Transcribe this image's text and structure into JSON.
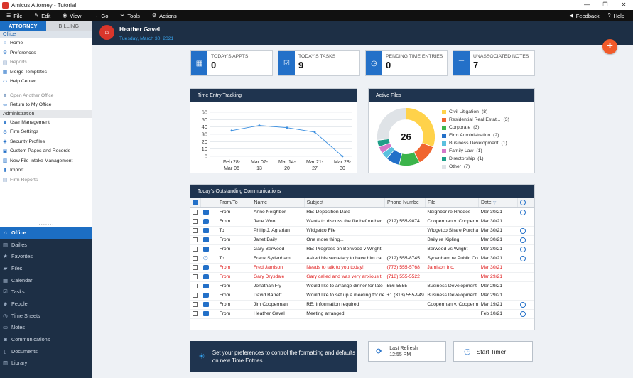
{
  "window": {
    "title": "Amicus Attorney - Tutorial",
    "controls": [
      "—",
      "❐",
      "✕"
    ]
  },
  "menubar": {
    "items": [
      {
        "label": "File",
        "icon": "hamburger-icon"
      },
      {
        "label": "Edit",
        "icon": "pencil-icon"
      },
      {
        "label": "View",
        "icon": "eye-icon"
      },
      {
        "label": "Go",
        "icon": "arrow-icon"
      },
      {
        "label": "Tools",
        "icon": "wrench-icon"
      },
      {
        "label": "Actions",
        "icon": "gear-icon"
      }
    ],
    "right": [
      {
        "label": "Feedback",
        "icon": "megaphone-icon"
      },
      {
        "label": "Help",
        "icon": "help-icon"
      }
    ]
  },
  "sidebar": {
    "tabs": [
      "ATTORNEY",
      "BILLING"
    ],
    "office_header": "Office",
    "office_links": [
      {
        "label": "Home",
        "enabled": true
      },
      {
        "label": "Preferences",
        "enabled": true
      },
      {
        "label": "Reports",
        "enabled": false
      },
      {
        "label": "Merge Templates",
        "enabled": true
      },
      {
        "label": "Help Center",
        "enabled": true
      }
    ],
    "other_links": [
      {
        "label": "Open Another Office",
        "enabled": false
      },
      {
        "label": "Return to My Office",
        "enabled": true
      }
    ],
    "admin_header": "Administration",
    "admin_links": [
      {
        "label": "User Management",
        "enabled": true
      },
      {
        "label": "Firm Settings",
        "enabled": true
      },
      {
        "label": "Security Profiles",
        "enabled": true
      },
      {
        "label": "Custom Pages and Records",
        "enabled": true
      },
      {
        "label": "New File Intake Management",
        "enabled": true
      },
      {
        "label": "Import",
        "enabled": true
      },
      {
        "label": "Firm Reports",
        "enabled": false
      }
    ],
    "nav": [
      "Office",
      "Dailies",
      "Favorites",
      "Files",
      "Calendar",
      "Tasks",
      "People",
      "Time Sheets",
      "Notes",
      "Communications",
      "Documents",
      "Library"
    ],
    "nav_active": "Office"
  },
  "header": {
    "user_name": "Heather Gavel",
    "date": "Tuesday, March 30, 2021",
    "fab_label": "+"
  },
  "kpis": [
    {
      "label": "TODAY'S APPTS",
      "value": "0",
      "icon": "calendar-icon"
    },
    {
      "label": "TODAY'S TASKS",
      "value": "9",
      "icon": "checkbox-icon"
    },
    {
      "label": "PENDING TIME ENTRIES",
      "value": "0",
      "icon": "clock-icon"
    },
    {
      "label": "UNASSOCIATED NOTES",
      "value": "7",
      "icon": "note-icon"
    }
  ],
  "time_panel_title": "Time Entry Tracking",
  "chart_data": {
    "type": "line",
    "categories": [
      "Feb 28-\nMar 06",
      "Mar 07-\n13",
      "Mar 14-\n20",
      "Mar 21-\n27",
      "Mar 28-\n30"
    ],
    "values": [
      35,
      42,
      39,
      33,
      0
    ],
    "ylim": [
      0,
      60
    ],
    "yticks": [
      0,
      10,
      20,
      30,
      40,
      50,
      60
    ],
    "title": "",
    "xlabel": "",
    "ylabel": "",
    "grid": true,
    "color": "#3b8fe0"
  },
  "active_files": {
    "title": "Active Files",
    "total": "26",
    "items": [
      {
        "label": "Civil Litigation",
        "count": "(8)",
        "value": 8,
        "color": "#ffd24a"
      },
      {
        "label": "Residential Real Estat...",
        "count": "(3)",
        "value": 3,
        "color": "#f0652f"
      },
      {
        "label": "Corporate",
        "count": "(3)",
        "value": 3,
        "color": "#3cb44b"
      },
      {
        "label": "Firm Administration",
        "count": "(2)",
        "value": 2,
        "color": "#2370c8"
      },
      {
        "label": "Business Development",
        "count": "(1)",
        "value": 1,
        "color": "#5bc0de"
      },
      {
        "label": "Family Law",
        "count": "(1)",
        "value": 1,
        "color": "#d477c9"
      },
      {
        "label": "Directorship",
        "count": "(1)",
        "value": 1,
        "color": "#1f9e89"
      },
      {
        "label": "Other",
        "count": "(7)",
        "value": 7,
        "color": "#dfe3e7"
      }
    ]
  },
  "communications": {
    "title": "Today's Outstanding Communications",
    "columns": [
      "From/To",
      "Name",
      "Subject",
      "Phone Numbe",
      "File",
      "Date"
    ],
    "rows": [
      {
        "type": "email",
        "dir": "From",
        "name": "Anne Neighbor",
        "subject": "RE: Deposition Date",
        "phone": "",
        "file": "Neighbor re Rhodes",
        "date": "Mar 30/21",
        "clock": true,
        "red": false
      },
      {
        "type": "note",
        "dir": "From",
        "name": "Jane Woo",
        "subject": "Wants to discuss the file before her",
        "phone": "(212) 555-9874",
        "file": "Cooperman v. Cooperm",
        "date": "Mar 30/21",
        "clock": false,
        "red": false
      },
      {
        "type": "email",
        "dir": "To",
        "name": "Philip J. Agrarian",
        "subject": "Widgetco File",
        "phone": "",
        "file": "Widgetco Share Purcha",
        "date": "Mar 30/21",
        "clock": true,
        "red": false
      },
      {
        "type": "email",
        "dir": "From",
        "name": "Janet Baily",
        "subject": "One more thing...",
        "phone": "",
        "file": "Baily re Kipling",
        "date": "Mar 30/21",
        "clock": true,
        "red": false
      },
      {
        "type": "email",
        "dir": "From",
        "name": "Gary Berwood",
        "subject": "RE: Progress on Berwood v Wright",
        "phone": "",
        "file": "Berwood vs Wright",
        "date": "Mar 30/21",
        "clock": true,
        "red": false
      },
      {
        "type": "phone",
        "dir": "To",
        "name": "Frank Sydenham",
        "subject": "Asked his secretary to have him ca",
        "phone": "(212) 555-8745",
        "file": "Sydenham re Public Co",
        "date": "Mar 30/21",
        "clock": true,
        "red": false
      },
      {
        "type": "note",
        "dir": "From",
        "name": "Fred Jamison",
        "subject": "Needs to talk to you today!",
        "phone": "(773) 555-5768",
        "file": "Jamison Inc.",
        "date": "Mar 30/21",
        "clock": false,
        "red": true
      },
      {
        "type": "note",
        "dir": "From",
        "name": "Gary Drysdale",
        "subject": "Gary called and was very anxious t",
        "phone": "(718) 555-5522",
        "file": "",
        "date": "Mar 29/21",
        "clock": false,
        "red": true
      },
      {
        "type": "note",
        "dir": "From",
        "name": "Jonathan Fly",
        "subject": "Would like to arrange dinner for late",
        "phone": "556-5555",
        "file": "Business Development",
        "date": "Mar 29/21",
        "clock": false,
        "red": false
      },
      {
        "type": "note",
        "dir": "From",
        "name": "David Barrett",
        "subject": "Would like to set up a meeting for ne",
        "phone": "+1 (313) 555-949",
        "file": "Business Development",
        "date": "Mar 29/21",
        "clock": false,
        "red": false
      },
      {
        "type": "email",
        "dir": "From",
        "name": "Jim Cooperman",
        "subject": "RE: Information required",
        "phone": "",
        "file": "Cooperman v. Cooperm",
        "date": "Mar 19/21",
        "clock": true,
        "red": false
      },
      {
        "type": "email",
        "dir": "From",
        "name": "Heather Gavel",
        "subject": "Meeting arranged",
        "phone": "",
        "file": "",
        "date": "Feb 10/21",
        "clock": true,
        "red": false
      }
    ]
  },
  "footer": {
    "tip": "Set your preferences to control the formatting and defaults on new Time Entries",
    "last_refresh_label": "Last Refresh",
    "last_refresh_time": "12:55 PM",
    "start_timer": "Start Timer"
  }
}
